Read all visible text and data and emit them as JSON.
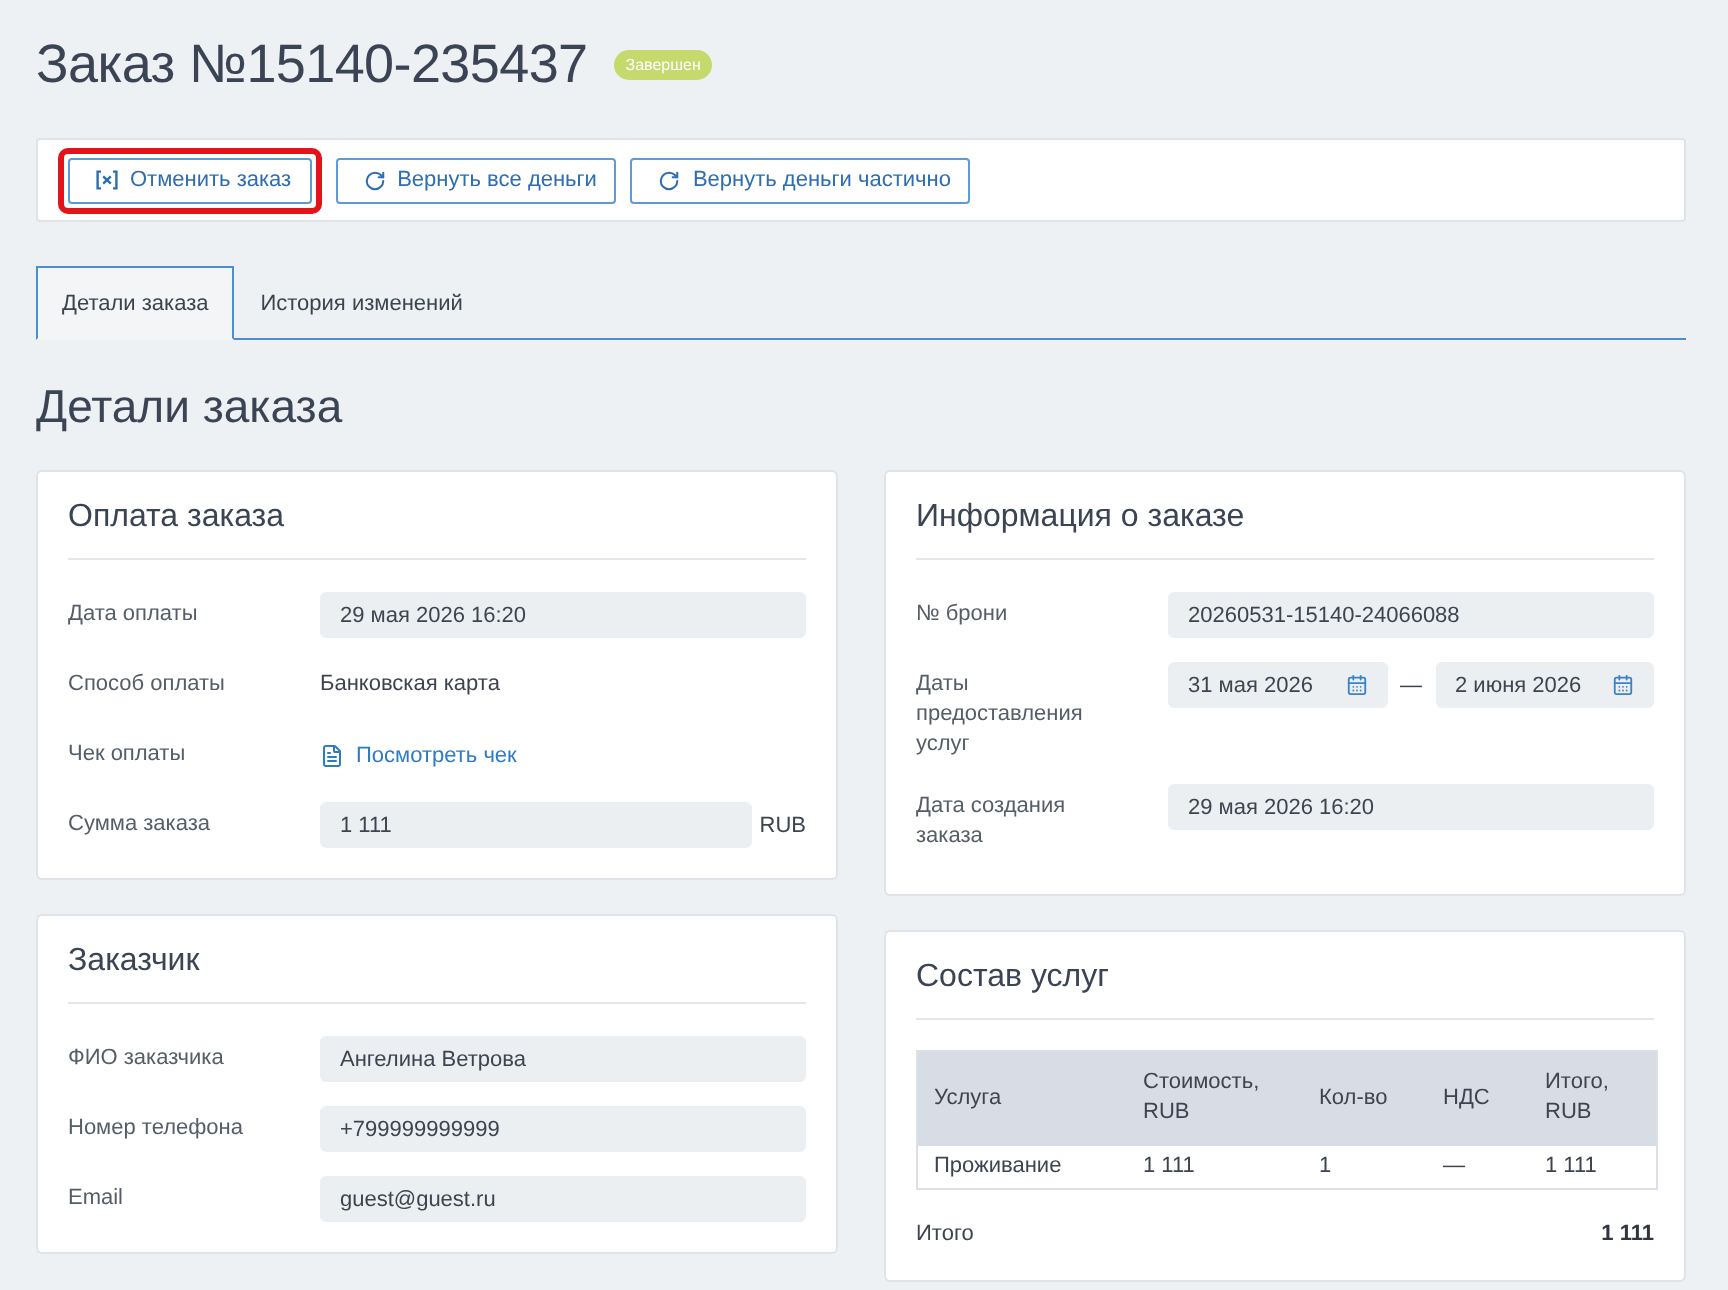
{
  "order": {
    "title": "Заказ №15140-235437",
    "status": {
      "label": "Завершен"
    }
  },
  "toolbar": {
    "buttons": [
      {
        "label": "Отменить заказ",
        "kind": "cancel",
        "highlighted": true
      },
      {
        "label": "Вернуть все деньги",
        "kind": "refund",
        "highlighted": false
      },
      {
        "label": "Вернуть деньги частично",
        "kind": "refund",
        "highlighted": false
      }
    ]
  },
  "tabs": [
    {
      "label": "Детали заказа",
      "selected": true
    },
    {
      "label": "История изменений",
      "selected": false
    }
  ],
  "section_title": "Детали заказа",
  "payment": {
    "title": "Оплата заказа",
    "rows": [
      {
        "kind": "field",
        "label": "Дата оплаты",
        "value": "29 мая 2026 16:20"
      },
      {
        "kind": "text",
        "label": "Способ оплаты",
        "value": "Банковская карта"
      },
      {
        "kind": "link",
        "label": "Чек оплаты",
        "value": "Посмотреть чек"
      },
      {
        "kind": "field",
        "label": "Сумма заказа",
        "value": "1 111",
        "unit": "RUB"
      }
    ]
  },
  "customer": {
    "title": "Заказчик",
    "rows": [
      {
        "kind": "field",
        "label": "ФИО заказчика",
        "value": "Ангелина Ветрова"
      },
      {
        "kind": "field",
        "label": "Номер телефона",
        "value": "+799999999999"
      },
      {
        "kind": "field",
        "label": "Email",
        "value": "guest@guest.ru"
      }
    ]
  },
  "order_info": {
    "title": "Информация о заказе",
    "rows": [
      {
        "kind": "field",
        "label": "№ брони",
        "value": "20260531-15140-24066088"
      },
      {
        "kind": "date_range",
        "label": "Даты предоставления услуг",
        "from": "31 мая 2026",
        "separator": "—",
        "to": "2 июня 2026"
      },
      {
        "kind": "field",
        "label": "Дата создания заказа",
        "value": "29 мая 2026 16:20"
      }
    ]
  },
  "services": {
    "title": "Состав услуг",
    "table": {
      "columns": [
        "Услуга",
        "Стоимость, RUB",
        "Кол-во",
        "НДС",
        "Итого, RUB"
      ],
      "rows": [
        [
          "Проживание",
          "1 111",
          "1",
          "—",
          "1 111"
        ]
      ]
    },
    "total": {
      "label": "Итого",
      "value": "1 111"
    }
  }
}
